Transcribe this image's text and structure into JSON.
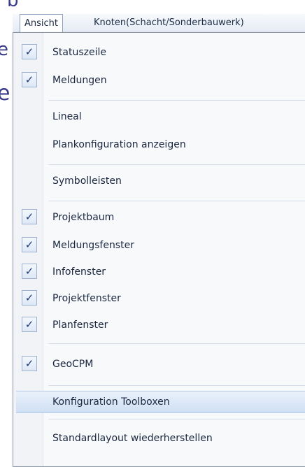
{
  "menubar": {
    "items": [
      "Ansicht",
      "Knoten(Schacht/Sonderbauwerk)"
    ]
  },
  "menu": {
    "items": [
      {
        "label": "Statuszeile",
        "checked": true
      },
      {
        "label": "Meldungen",
        "checked": true
      },
      {
        "label": "Lineal",
        "checked": false
      },
      {
        "label": "Plankonfiguration anzeigen",
        "checked": false
      },
      {
        "label": "Symbolleisten",
        "checked": false,
        "submenu": true
      },
      {
        "label": "Projektbaum",
        "checked": true
      },
      {
        "label": "Meldungsfenster",
        "checked": true
      },
      {
        "label": "Infofenster",
        "checked": true
      },
      {
        "label": "Projektfenster",
        "checked": true
      },
      {
        "label": "Planfenster",
        "checked": true
      },
      {
        "label": "GeoCPM",
        "checked": true
      },
      {
        "label": "Konfiguration Toolboxen",
        "checked": false,
        "highlighted": true
      },
      {
        "label": "Standardlayout wiederherstellen",
        "checked": false
      }
    ],
    "check_glyph": "✓",
    "submenu_arrow": "▸"
  },
  "colors": {
    "highlight": "#cfdff3",
    "check_border": "#9db1cf"
  }
}
